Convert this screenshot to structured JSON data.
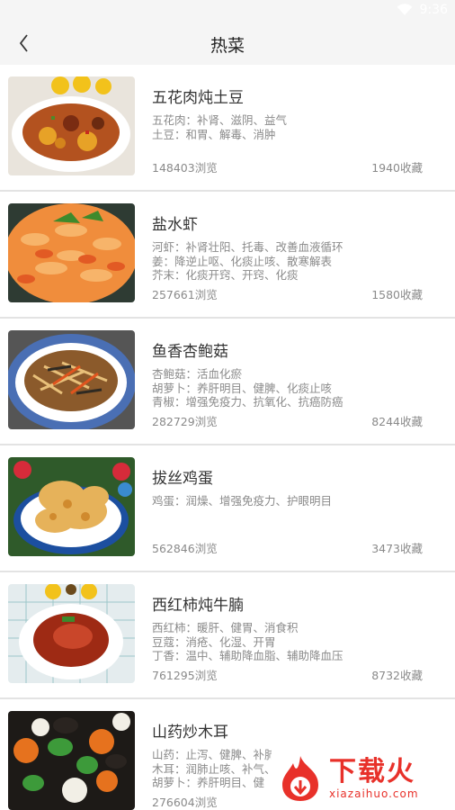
{
  "status": {
    "time": "9:36"
  },
  "header": {
    "title": "热菜"
  },
  "items": [
    {
      "name": "五花肉炖土豆",
      "desc": [
        "五花肉：补肾、滋阴、益气",
        "土豆：和胃、解毒、消肿"
      ],
      "views": "148403浏览",
      "favs": "1940收藏"
    },
    {
      "name": "盐水虾",
      "desc": [
        "河虾：补肾壮阳、托毒、改善血液循环",
        "姜：降逆止呕、化痰止咳、散寒解表",
        "芥末：化痰开窍、开窍、化痰"
      ],
      "views": "257661浏览",
      "favs": "1580收藏"
    },
    {
      "name": "鱼香杏鲍菇",
      "desc": [
        "杏鲍菇：活血化瘀",
        "胡萝卜：养肝明目、健脾、化痰止咳",
        "青椒：增强免疫力、抗氧化、抗癌防癌"
      ],
      "views": "282729浏览",
      "favs": "8244收藏"
    },
    {
      "name": "拔丝鸡蛋",
      "desc": [
        "鸡蛋：润燥、增强免疫力、护眼明目"
      ],
      "views": "562846浏览",
      "favs": "3473收藏"
    },
    {
      "name": "西红柿炖牛腩",
      "desc": [
        "西红柿：暖肝、健胃、消食积",
        "豆蔻：消疮、化湿、开胃",
        "丁香：温中、辅助降血脂、辅助降血压"
      ],
      "views": "761295浏览",
      "favs": "8732收藏"
    },
    {
      "name": "山药炒木耳",
      "desc": [
        "山药：止泻、健脾、补肺",
        "木耳：润肺止咳、补气、",
        "胡萝卜：养肝明目、健"
      ],
      "views": "276604浏览",
      "favs": ""
    }
  ],
  "watermark": {
    "text": "下载火",
    "url": "xiazaihuo.com"
  },
  "colors": {
    "accent": "#e8312a"
  }
}
